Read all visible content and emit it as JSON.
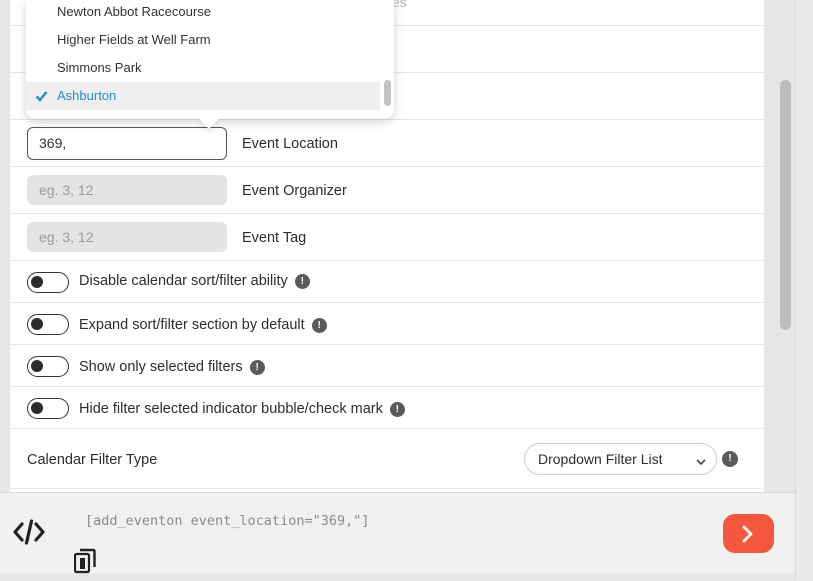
{
  "dropdown": {
    "partial_text": "es",
    "options": [
      {
        "label": "Newton Abbot Racecourse",
        "selected": false
      },
      {
        "label": "Higher Fields at Well Farm",
        "selected": false
      },
      {
        "label": "Simmons Park",
        "selected": false
      },
      {
        "label": "Ashburton",
        "selected": true
      }
    ]
  },
  "fields": [
    {
      "label": "Event Location",
      "value": "369,",
      "placeholder": ""
    },
    {
      "label": "Event Organizer",
      "value": "",
      "placeholder": "eg. 3, 12"
    },
    {
      "label": "Event Tag",
      "value": "",
      "placeholder": "eg. 3, 12"
    }
  ],
  "toggles": [
    {
      "label": "Disable calendar sort/filter ability",
      "on": false
    },
    {
      "label": "Expand sort/filter section by default",
      "on": false
    },
    {
      "label": "Show only selected filters",
      "on": false
    },
    {
      "label": "Hide filter selected indicator bubble/check mark",
      "on": false
    }
  ],
  "info_glyph": "!",
  "filter_type": {
    "label": "Calendar Filter Type",
    "selected": "Dropdown Filter List"
  },
  "shortcode": {
    "text": "[add_eventon event_location=\"369,\"]"
  },
  "colors": {
    "accent": "#1e8fd6",
    "go_button": "#f4573b"
  },
  "icons": {
    "code": "code-icon",
    "copy": "copy-icon",
    "go": "chevron-right-icon",
    "check": "checkmark-icon",
    "select_arrow": "chevron-down-icon",
    "info": "info-icon"
  }
}
